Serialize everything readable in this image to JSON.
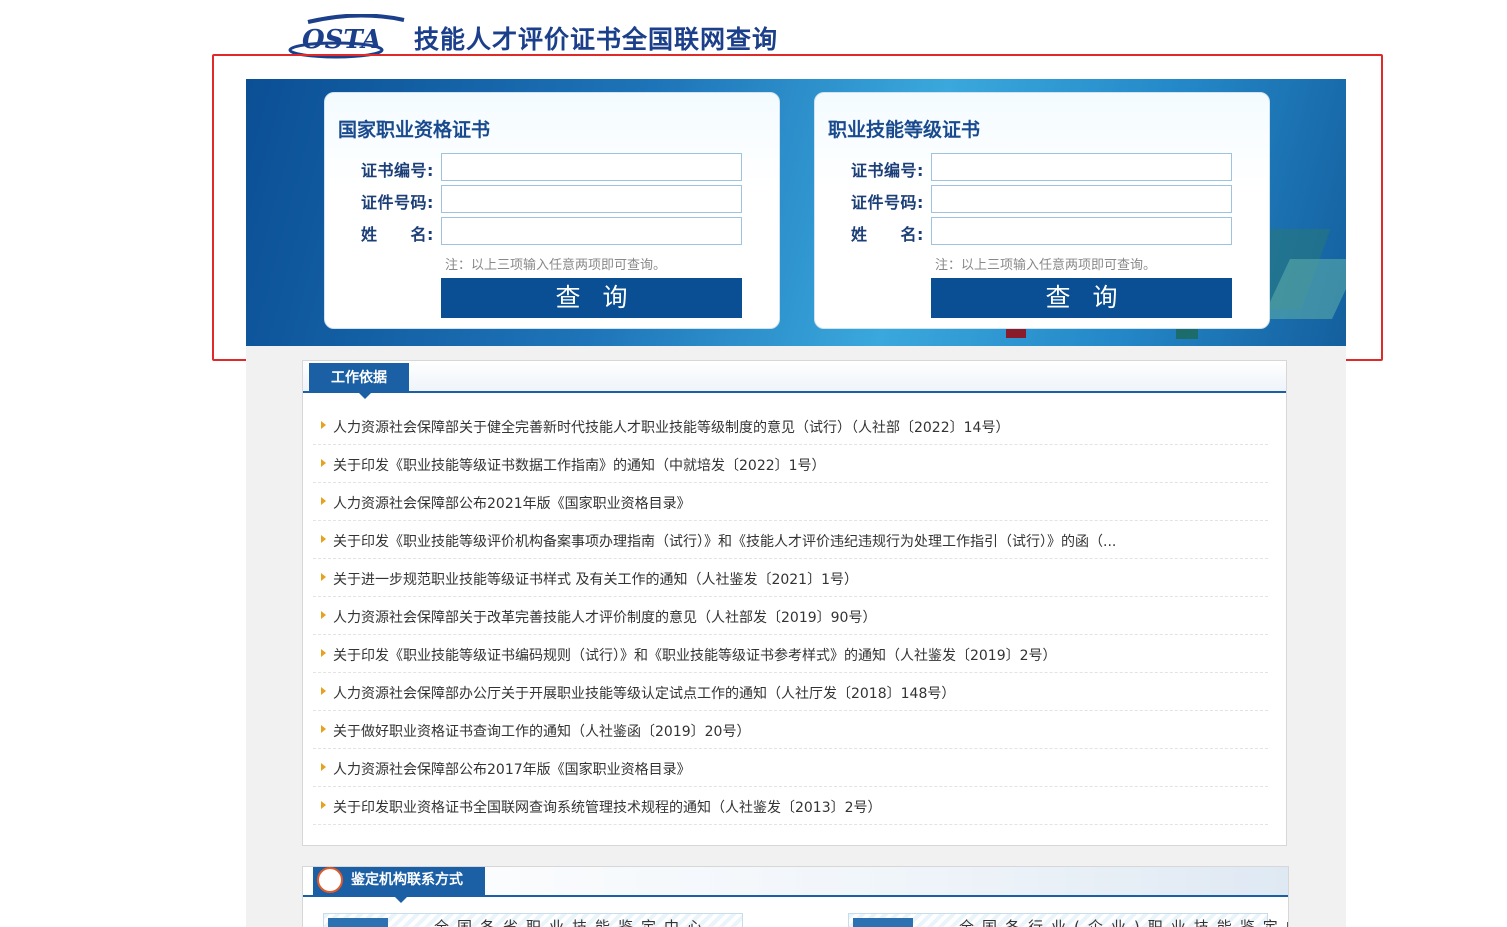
{
  "header": {
    "logo_text": "OSTA",
    "title": "技能人才评价证书全国联网查询"
  },
  "query_cards": [
    {
      "title": "国家职业资格证书",
      "fields": [
        {
          "label": "证书编号:",
          "value": ""
        },
        {
          "label": "证件号码:",
          "value": ""
        },
        {
          "label": "姓　　名:",
          "value": ""
        }
      ],
      "note": "注：以上三项输入任意两项即可查询。",
      "button": "查询"
    },
    {
      "title": "职业技能等级证书",
      "fields": [
        {
          "label": "证书编号:",
          "value": ""
        },
        {
          "label": "证件号码:",
          "value": ""
        },
        {
          "label": "姓　　名:",
          "value": ""
        }
      ],
      "note": "注：以上三项输入任意两项即可查询。",
      "button": "查询"
    }
  ],
  "work_basis": {
    "tab": "工作依据",
    "items": [
      "人力资源社会保障部关于健全完善新时代技能人才职业技能等级制度的意见（试行）（人社部〔2022〕14号）",
      "关于印发《职业技能等级证书数据工作指南》的通知（中就培发〔2022〕1号）",
      "人力资源社会保障部公布2021年版《国家职业资格目录》",
      "关于印发《职业技能等级评价机构备案事项办理指南（试行）》和《技能人才评价违纪违规行为处理工作指引（试行）》的函（...",
      "关于进一步规范职业技能等级证书样式 及有关工作的通知（人社鉴发〔2021〕1号）",
      "人力资源社会保障部关于改革完善技能人才评价制度的意见（人社部发〔2019〕90号）",
      "关于印发《职业技能等级证书编码规则（试行）》和《职业技能等级证书参考样式》的通知（人社鉴发〔2019〕2号）",
      "人力资源社会保障部办公厅关于开展职业技能等级认定试点工作的通知（人社厅发〔2018〕148号）",
      "关于做好职业资格证书查询工作的通知（人社鉴函〔2019〕20号）",
      "人力资源社会保障部公布2017年版《国家职业资格目录》",
      "关于印发职业资格证书全国联网查询系统管理技术规程的通知（人社鉴发〔2013〕2号）"
    ]
  },
  "agency": {
    "tab": "鉴定机构联系方式",
    "boxes": [
      "全国各省职业技能鉴定中心",
      "全国各行业(企业)职业技能鉴定中心"
    ]
  },
  "colors": {
    "brand_blue": "#1b3f8a",
    "button_blue": "#0a4f93",
    "highlight_red": "#e02a2a",
    "bullet_orange": "#e6a11d"
  }
}
